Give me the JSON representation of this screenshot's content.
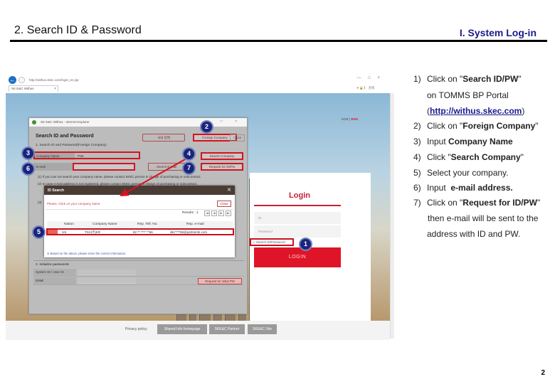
{
  "slide": {
    "title": "2. Search ID & Password",
    "section": "I. System Log-in",
    "page_number": "2"
  },
  "browser": {
    "url": "http://withus.skec.com/login_en.jsp",
    "tab_title": "SK E&C Withus",
    "toolbar_right": "▾ 🔒 ▏ 검색",
    "window_controls": "— □ ×",
    "lang_kor": "KOR",
    "lang_sep": "|",
    "lang_eng": "ENG"
  },
  "login": {
    "title": "Login",
    "id_placeholder": "ID",
    "password_placeholder": "Password",
    "search_link": "» Search ID/Password",
    "login_button": "LOGIN"
  },
  "footer": {
    "privacy": "Privacy policy",
    "buttons": [
      "Shared Info homepage",
      "SKE&C Partner",
      "SKE&C Site"
    ]
  },
  "popup": {
    "window_title": "SK E&C Withus - Internet Explorer",
    "window_controls": "□ ×",
    "heading": "Search ID and Password",
    "btn_korean": "국내 업체",
    "btn_foreign": "Foreign Company",
    "btn_close": "Close",
    "section1": "1. Search ID and Password(Foreign Company)",
    "company_label": "Company Name",
    "company_value": "PSK",
    "email_label": "E-mail",
    "btn_search_company": "Search Company",
    "btn_search_email": "Search E-mail",
    "btn_request": "Request for ID/Pw",
    "note1": "(1) If you can not search your company name, please contact SKEC person in charge of purchasing or subcontract.",
    "note2": "(2) In case e-mail address is not registered, please contact SKEC person in charge of purchasing or subcontract.",
    "note3": "(3)",
    "section2": "2. Initialize passwords",
    "sec2_row1_label": "System ID / User ID",
    "sec2_row2_label": "EMail",
    "btn_init_pw": "Request for initial PW"
  },
  "id_search": {
    "title": "ID Search",
    "close_x": "✕",
    "prompt": "Please, Click on your company name.",
    "close": "Close",
    "results": "Results : 1",
    "pager": [
      "|◀",
      "◀",
      "▶",
      "▶|"
    ],
    "columns": [
      "Nation",
      "Company Name",
      "Rep. Tell. No.",
      "Rep. e-mail"
    ],
    "row": {
      "nation": "US",
      "company": "TSA(주)KR",
      "tel": "82 ** **** **66",
      "email": "dkc****55@partnersk.com"
    },
    "footnote": "※ Based on the above, please enter the correct information."
  },
  "badges": [
    "1",
    "2",
    "3",
    "4",
    "5",
    "6",
    "7"
  ],
  "steps": [
    {
      "num": "1)",
      "pre": "Click on \"",
      "bold": "Search ID/PW",
      "post": "\""
    },
    {
      "num": "2)",
      "pre": "Click on \"",
      "bold": "Foreign Company",
      "post": "\""
    },
    {
      "num": "3)",
      "pre": "Input ",
      "bold": "Company Name",
      "post": ""
    },
    {
      "num": "4)",
      "pre": "Click \"",
      "bold": "Search Company",
      "post": "\""
    },
    {
      "num": "5)",
      "pre": "Select your company.",
      "bold": "",
      "post": ""
    },
    {
      "num": "6)",
      "pre": "Input  ",
      "bold": "e-mail address.",
      "post": ""
    },
    {
      "num": "7)",
      "pre": "Click on \"",
      "bold": "Request for ID/PW",
      "post": "\""
    }
  ],
  "step1_cont": {
    "line1": "on TOMMS BP Portal",
    "url_open": "(",
    "url": "http://withus.skec.com",
    "url_close": ")"
  },
  "step7_cont": {
    "line1": "then e-mail will be sent to the",
    "line2": "address with ID and PW."
  },
  "colors": {
    "title_blue": "#1a1a8c",
    "highlight_red": "#d7131f",
    "badge_navy": "#1a237e",
    "login_red": "#e01428"
  }
}
